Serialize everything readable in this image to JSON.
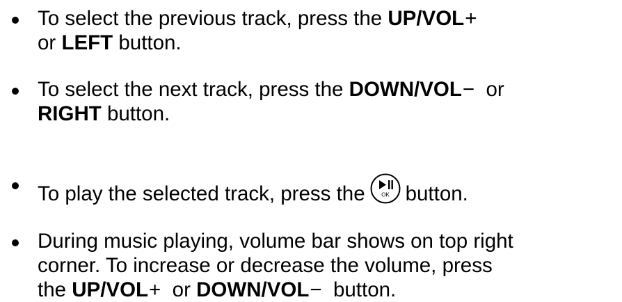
{
  "items": [
    {
      "line1": {
        "text_a": "To select the previous track, press the ",
        "bold_a": "UP/VOL",
        "sym_a": "+"
      },
      "line2": {
        "text_a": "or ",
        "bold_a": "LEFT",
        "text_b": " button."
      }
    },
    {
      "line1": {
        "text_a": "To select the next track, press the ",
        "bold_a": "DOWN/VOL",
        "sym_a": "−",
        "text_b": "  or"
      },
      "line2": {
        "bold_a": "RIGHT",
        "text_b": " button."
      }
    },
    {
      "line1": {
        "text_a": "To play the selected track, press the",
        "icon": "play-pause-ok-icon",
        "icon_label": "OK",
        "text_b": "button."
      }
    },
    {
      "line1": {
        "text_a": "During music playing, volume bar shows on top right"
      },
      "line2": {
        "text_a": "corner. To increase or decrease the volume, press"
      },
      "line3": {
        "text_a": "the ",
        "bold_a": "UP/VOL",
        "sym_a": "+",
        "text_b": "  or ",
        "bold_b": "DOWN/VOL",
        "sym_b": "−",
        "text_c": "  button."
      }
    }
  ]
}
